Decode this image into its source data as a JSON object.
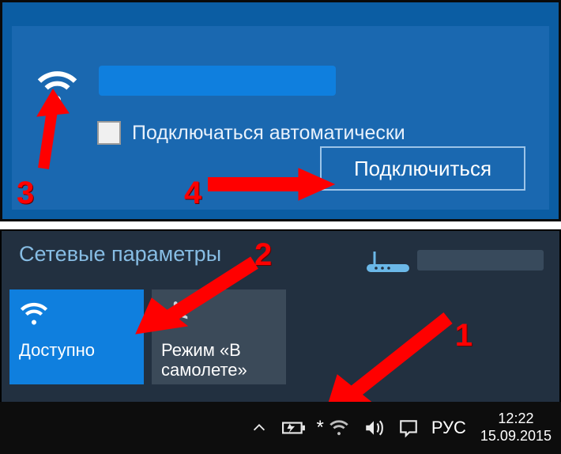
{
  "network": {
    "auto_connect_label": "Подключаться автоматически",
    "connect_button": "Подключиться"
  },
  "settings": {
    "title": "Сетевые параметры"
  },
  "tiles": {
    "wifi_label": "Доступно",
    "airplane_label": "Режим «В самолете»"
  },
  "taskbar": {
    "lang": "РУС",
    "time": "12:22",
    "date": "15.09.2015"
  },
  "annotations": {
    "n1": "1",
    "n2": "2",
    "n3": "3",
    "n4": "4"
  }
}
